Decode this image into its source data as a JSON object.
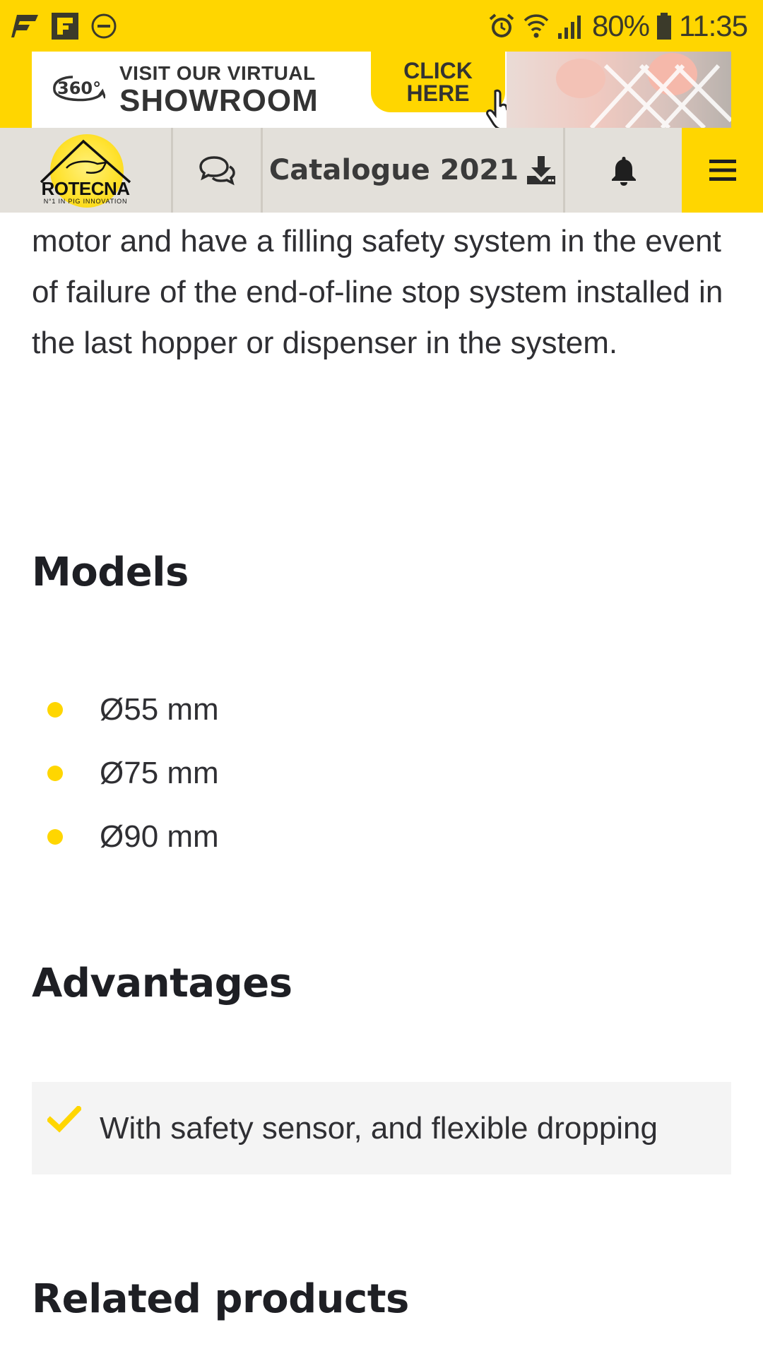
{
  "status_bar": {
    "battery": "80%",
    "time": "11:35",
    "icons": [
      "flipboard-icon",
      "app-notification-icon",
      "do-not-disturb-icon",
      "alarm-icon",
      "wifi-icon",
      "signal-icon",
      "battery-icon"
    ]
  },
  "banner": {
    "badge": "360°",
    "line1": "VISIT OUR VIRTUAL",
    "line2": "SHOWROOM",
    "cta_line1": "CLICK",
    "cta_line2": "HERE"
  },
  "navbar": {
    "logo_text": "ROTECNA",
    "logo_tagline": "N°1 IN PIG INNOVATION",
    "catalogue_label": "Catalogue 2021",
    "icons": [
      "chat-icon",
      "download-icon",
      "bell-icon",
      "hamburger-menu-icon"
    ]
  },
  "content": {
    "intro": "motor and have a filling safety system in the event of failure of the end-of-line stop system installed in the last hopper or dispenser in the system.",
    "models_heading": "Models",
    "models": [
      "Ø55 mm",
      "Ø75 mm",
      "Ø90 mm"
    ],
    "advantages_heading": "Advantages",
    "advantages": [
      "With safety sensor, and flexible dropping"
    ],
    "related_heading": "Related products"
  },
  "colors": {
    "brand_yellow": "#ffd600",
    "nav_gray": "#e3e0da",
    "text_dark": "#1e1f24"
  }
}
